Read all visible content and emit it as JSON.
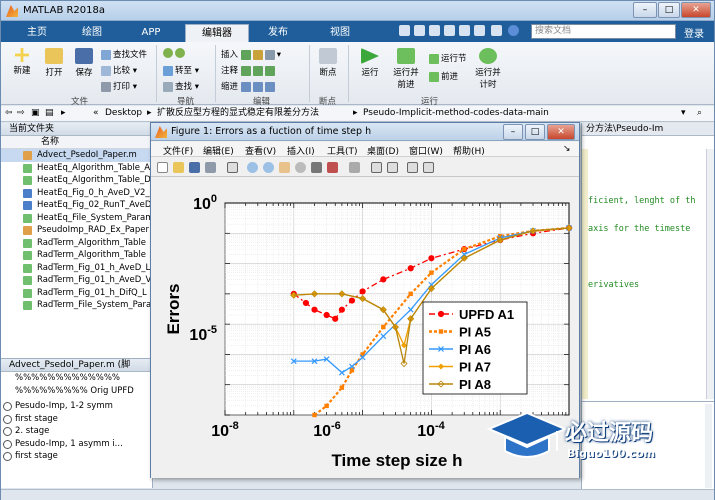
{
  "window": {
    "title": "MATLAB R2018a"
  },
  "ribbon_tabs": [
    "主页",
    "绘图",
    "APP",
    "编辑器",
    "发布",
    "视图"
  ],
  "search_placeholder": "搜索文档",
  "signin": "登录",
  "ribbon": {
    "file": {
      "new": "新建",
      "open": "打开",
      "save": "保存",
      "find_files": "查找文件",
      "compare": "比较",
      "print": "打印",
      "group": "文件"
    },
    "nav": {
      "goto": "转至",
      "find": "查找",
      "group": "导航"
    },
    "edit": {
      "insert": "插入",
      "comment": "注释",
      "indent": "缩进",
      "group": "编辑"
    },
    "breakpoints": {
      "label": "断点",
      "group": "断点"
    },
    "run": {
      "run": "运行",
      "run_advance": "运行并\n前进",
      "run_section": "运行节",
      "advance": "前进",
      "run_time": "运行并\n计时",
      "group": "运行"
    }
  },
  "address": {
    "parts": [
      "«",
      "Desktop",
      "▸",
      "扩散反应型方程的显式稳定有限差分方法",
      "▸",
      "Pseudo-Implicit-method-codes-data-main"
    ]
  },
  "current_folder": {
    "title": "当前文件夹",
    "column": "名称",
    "files": [
      "Advect_PsedoI_Paper.m",
      "HeatEq_Algorithm_Table_A",
      "HeatEq_Algorithm_Table_D",
      "HeatEq_Fig_0_h_AveD_V2_",
      "HeatEq_Fig_02_RunT_AveD",
      "HeatEq_File_System_Param",
      "PseudoImp_RAD_Ex_Paper",
      "RadTerm_Algorithm_Table",
      "RadTerm_Algorithm_Table",
      "RadTerm_Fig_01_h_AveD_L",
      "RadTerm_Fig_01_h_AveD_V",
      "RadTerm_Fig_01_h_DifQ_L",
      "RadTerm_File_System_Para"
    ]
  },
  "details": {
    "title": "Advect_PsedoI_Paper.m (脚",
    "lines": [
      "%%%%%%%%%%%%%",
      "%%%%%%%%% Orig UPFD",
      "Pesudo-Imp, 1-2 symm",
      "first stage",
      "2. stage",
      "Pesudo-Imp, 1 asymm i...",
      "first stage"
    ]
  },
  "editor": {
    "tab": "分方法\\Pseudo-Im",
    "lines": [
      "ficient, lenght of th",
      "axis for the timeste",
      "erivatives"
    ]
  },
  "figure": {
    "title": "Figure 1: Errors as a fuction of time step h",
    "menu": [
      "文件(F)",
      "编辑(E)",
      "查看(V)",
      "插入(I)",
      "工具(T)",
      "桌面(D)",
      "窗口(W)",
      "帮助(H)"
    ]
  },
  "chart_data": {
    "type": "line",
    "xscale": "log",
    "yscale": "log",
    "xlabel": "Time step size h",
    "ylabel": "Errors",
    "xlim": [
      1e-08,
      0.001
    ],
    "ylim": [
      1e-07,
      1
    ],
    "xticks": [
      "10-8",
      "10-6",
      "10-4"
    ],
    "yticks": [
      "100",
      "10-5"
    ],
    "legend": "bottom-right",
    "grid": true,
    "series": [
      {
        "name": "UPFD A1",
        "color": "#ff0000",
        "marker": "circle",
        "style": "dash-dot",
        "x": [
          1e-07,
          1.5e-07,
          2e-07,
          3e-07,
          4e-07,
          5e-07,
          7e-07,
          1e-06,
          2e-06,
          5e-06,
          1e-05,
          3e-05,
          0.0001,
          0.0003,
          0.001
        ],
        "y": [
          0.001,
          0.0005,
          0.0003,
          0.0002,
          0.00015,
          0.0003,
          0.0006,
          0.0012,
          0.003,
          0.007,
          0.015,
          0.03,
          0.06,
          0.1,
          0.15
        ]
      },
      {
        "name": "PI A5",
        "color": "#ff8000",
        "marker": "square",
        "style": "dotted",
        "x": [
          2e-07,
          3e-07,
          5e-07,
          7e-07,
          1e-06,
          2e-06,
          5e-06,
          1e-05,
          3e-05,
          0.0001,
          0.0003,
          0.001
        ],
        "y": [
          1e-07,
          2e-07,
          8e-07,
          3e-06,
          1e-05,
          8e-05,
          0.001,
          0.005,
          0.03,
          0.08,
          0.12,
          0.15
        ]
      },
      {
        "name": "PI A6",
        "color": "#3399ff",
        "marker": "x",
        "style": "solid",
        "x": [
          1e-07,
          2e-07,
          3e-07,
          5e-07,
          7e-07,
          1e-06,
          2e-06,
          5e-06,
          1e-05,
          3e-05,
          0.0001,
          0.0003,
          0.001
        ],
        "y": [
          6e-06,
          6e-06,
          7e-06,
          2.5e-06,
          4e-06,
          8e-06,
          4e-05,
          0.0003,
          0.002,
          0.02,
          0.07,
          0.12,
          0.15
        ]
      },
      {
        "name": "PI A7",
        "color": "#f0a000",
        "marker": "diamond",
        "style": "solid",
        "x": [
          1e-07,
          2e-07,
          5e-07,
          1e-06,
          2e-06,
          3e-06,
          4e-06,
          5e-06,
          1e-05,
          3e-05,
          0.0001,
          0.0003,
          0.001
        ],
        "y": [
          0.0009,
          0.001,
          0.001,
          0.0007,
          0.0003,
          8e-05,
          2e-05,
          0.00015,
          0.0015,
          0.015,
          0.06,
          0.12,
          0.15
        ]
      },
      {
        "name": "PI A8",
        "color": "#b8860b",
        "marker": "diamond-open",
        "style": "solid",
        "x": [
          1e-07,
          2e-07,
          5e-07,
          1e-06,
          2e-06,
          3e-06,
          4e-06,
          5e-06,
          1e-05,
          3e-05,
          0.0001,
          0.0003,
          0.001
        ],
        "y": [
          0.0009,
          0.001,
          0.001,
          0.0007,
          0.0003,
          8e-05,
          5e-06,
          0.00015,
          0.0015,
          0.015,
          0.06,
          0.12,
          0.15
        ]
      }
    ]
  },
  "watermark": {
    "cn": "必过源码",
    "url": "Biguo100.com"
  }
}
